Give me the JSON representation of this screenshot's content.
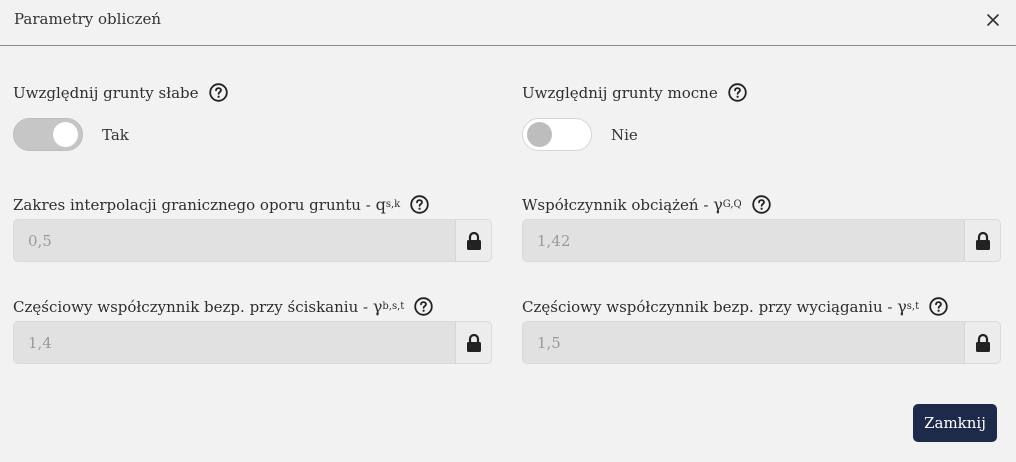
{
  "dialog": {
    "title": "Parametry obliczeń",
    "close_button_label": "Zamknij"
  },
  "fields": {
    "weak_soils": {
      "label": "Uwzględnij grunty słabe",
      "state_text": "Tak",
      "enabled": true
    },
    "strong_soils": {
      "label": "Uwzględnij grunty mocne",
      "state_text": "Nie",
      "enabled": false
    },
    "interpolation": {
      "label": "Zakres interpolacji granicznego oporu gruntu - ",
      "symbol": "q",
      "sub": "s,k",
      "value": "0,5"
    },
    "load_factor": {
      "label": "Współczynnik obciążeń - ",
      "symbol": "γ",
      "sub": "G,Q",
      "value": "1,42"
    },
    "compression_factor": {
      "label": "Częściowy współczynnik bezp. przy ściskaniu - ",
      "symbol": "γ",
      "sub": "b,s,t",
      "value": "1,4"
    },
    "tension_factor": {
      "label": "Częściowy współczynnik bezp. przy wyciąganiu - ",
      "symbol": "γ",
      "sub": "s,t",
      "value": "1,5"
    }
  },
  "colors": {
    "primary_button": "#1d2a4a",
    "background": "#f2f2f2",
    "input_disabled": "#e1e1e1"
  },
  "icons": [
    "close-icon",
    "help-icon",
    "lock-icon"
  ]
}
